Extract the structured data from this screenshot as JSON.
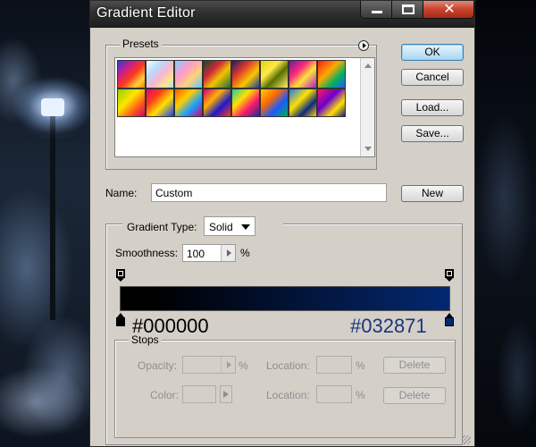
{
  "window": {
    "title": "Gradient Editor",
    "close_glyph": "✕"
  },
  "presets": {
    "label": "Presets",
    "swatches": [
      {
        "name": "preset-gradient-1",
        "css": "linear-gradient(135deg,#2b3fd8 0%,#c81e8a 30%,#ff3a1a 55%,#ffd23a 80%,#ff7a00 100%)"
      },
      {
        "name": "preset-gradient-2",
        "css": "linear-gradient(135deg,#ffffff 0%,#b7dcff 30%,#f7b6d2 55%,#ffe58a 80%,#9fe1ff 100%)"
      },
      {
        "name": "preset-gradient-3",
        "css": "linear-gradient(135deg,#7fd1ff 0%,#ff99cc 35%,#ffd27a 65%,#5cc5ff 100%)"
      },
      {
        "name": "preset-gradient-4",
        "css": "linear-gradient(135deg,#0c4b2a 0%,#d12a3a 35%,#f2c300 60%,#1a6e3a 100%)"
      },
      {
        "name": "preset-gradient-5",
        "css": "linear-gradient(135deg,#1a1a6e 0%,#e23a2a 35%,#f7c600 65%,#1a3aa0 100%)"
      },
      {
        "name": "preset-gradient-6",
        "css": "linear-gradient(135deg,#e6d200 0%,#ffe94a 35%,#5a6e00 60%,#fff070 100%)"
      },
      {
        "name": "preset-gradient-7",
        "css": "linear-gradient(135deg,#6a1aa0 0%,#ff2a7a 35%,#ffe23a 60%,#b01ad0 100%)"
      },
      {
        "name": "preset-gradient-8",
        "css": "linear-gradient(135deg,#ff1a1a 0%,#ffaa00 40%,#00b060 70%,#2a5aff 100%)"
      },
      {
        "name": "preset-gradient-9",
        "css": "linear-gradient(135deg,#8fd000 0%,#ffe600 40%,#ff5a1a 70%,#d00070 100%)"
      },
      {
        "name": "preset-gradient-10",
        "css": "linear-gradient(135deg,#e6007a 0%,#ff3a1a 30%,#ffe000 60%,#1a3aff 100%)"
      },
      {
        "name": "preset-gradient-11",
        "css": "linear-gradient(135deg,#ff5a00 0%,#ffd000 35%,#1aa0ff 65%,#d0007a 100%)"
      },
      {
        "name": "preset-gradient-12",
        "css": "linear-gradient(135deg,#d0007a 0%,#ffb000 35%,#1a1ad0 65%,#ff3a1a 100%)"
      },
      {
        "name": "preset-gradient-13",
        "css": "linear-gradient(135deg,#1ad0a0 0%,#ffe000 35%,#ff1a6a 65%,#1a2aa0 100%)"
      },
      {
        "name": "preset-gradient-14",
        "css": "linear-gradient(135deg,#ffd000 0%,#ff6a00 35%,#1a5aff 65%,#00b050 100%)"
      },
      {
        "name": "preset-gradient-15",
        "css": "linear-gradient(135deg,#1a7aff 0%,#ffe000 40%,#0a2a80 70%,#ffd000 100%)"
      },
      {
        "name": "preset-gradient-16",
        "css": "linear-gradient(135deg,#ff1a5a 0%,#6a00d0 40%,#ffe000 70%,#1a1a80 100%)"
      }
    ]
  },
  "buttons": {
    "ok": "OK",
    "cancel": "Cancel",
    "load": "Load...",
    "save": "Save...",
    "new": "New",
    "delete": "Delete"
  },
  "name_field": {
    "label": "Name:",
    "value": "Custom"
  },
  "gradient": {
    "type_label": "Gradient Type:",
    "type_value": "Solid",
    "smoothness_label": "Smoothness:",
    "smoothness_value": "100",
    "percent": "%",
    "start_color": "#000000",
    "end_color": "#032871",
    "start_color_label": "#000000",
    "end_color_label": "#032871"
  },
  "stops": {
    "label": "Stops",
    "opacity_label": "Opacity:",
    "color_label": "Color:",
    "location_label": "Location:",
    "percent": "%"
  },
  "colors": {
    "end_hex_text": "#1a3580",
    "dialog_bg": "#d4d0c8"
  }
}
